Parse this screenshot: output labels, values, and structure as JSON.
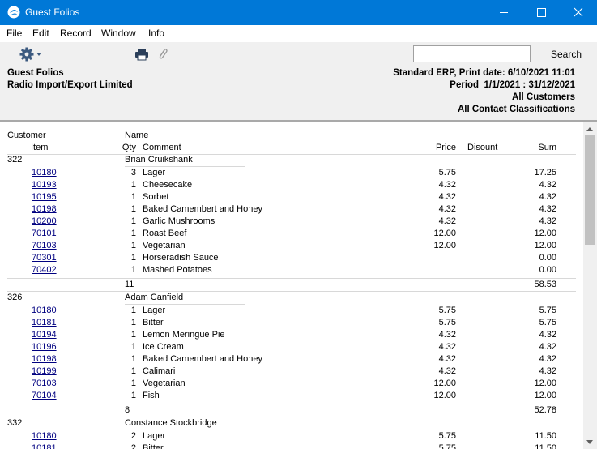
{
  "window": {
    "title": "Guest Folios",
    "minimize_glyph": "—",
    "maximize_glyph": "☐",
    "close_glyph": "✕"
  },
  "menu": [
    "File",
    "Edit",
    "Record",
    "Window",
    "Info"
  ],
  "toolbar": {
    "search_label": "Search",
    "search_value": ""
  },
  "icons": {
    "gear": "gear-icon",
    "print": "printer-icon",
    "attach": "paperclip-icon",
    "app": "app-logo-icon"
  },
  "colors": {
    "titlebar": "#0078d7",
    "link": "#000080",
    "header_bg": "#f0f0f0"
  },
  "header": {
    "report_name": "Guest Folios",
    "company": "Radio Import/Export Limited",
    "print_line": "Standard ERP, Print date: 6/10/2021 11:01",
    "period_line": "Period  1/1/2021 : 31/12/2021",
    "customers_line": "All Customers",
    "classifications_line": "All Contact Classifications"
  },
  "columns": {
    "customer": "Customer",
    "name": "Name",
    "item": "Item",
    "qty": "Qty",
    "comment": "Comment",
    "price": "Price",
    "discount": "Disount",
    "sum": "Sum"
  },
  "groups": [
    {
      "customer": "322",
      "name": "Brian Cruikshank",
      "rows": [
        {
          "item": "10180",
          "qty": "3",
          "comment": "Lager",
          "price": "5.75",
          "sum": "17.25"
        },
        {
          "item": "10193",
          "qty": "1",
          "comment": "Cheesecake",
          "price": "4.32",
          "sum": "4.32"
        },
        {
          "item": "10195",
          "qty": "1",
          "comment": "Sorbet",
          "price": "4.32",
          "sum": "4.32"
        },
        {
          "item": "10198",
          "qty": "1",
          "comment": "Baked Camembert and Honey",
          "price": "4.32",
          "sum": "4.32"
        },
        {
          "item": "10200",
          "qty": "1",
          "comment": "Garlic Mushrooms",
          "price": "4.32",
          "sum": "4.32"
        },
        {
          "item": "70101",
          "qty": "1",
          "comment": "Roast Beef",
          "price": "12.00",
          "sum": "12.00"
        },
        {
          "item": "70103",
          "qty": "1",
          "comment": "Vegetarian",
          "price": "12.00",
          "sum": "12.00"
        },
        {
          "item": "70301",
          "qty": "1",
          "comment": "Horseradish Sauce",
          "price": "",
          "sum": "0.00"
        },
        {
          "item": "70402",
          "qty": "1",
          "comment": "Mashed Potatoes",
          "price": "",
          "sum": "0.00"
        }
      ],
      "total_qty": "11",
      "total_sum": "58.53"
    },
    {
      "customer": "326",
      "name": "Adam Canfield",
      "rows": [
        {
          "item": "10180",
          "qty": "1",
          "comment": "Lager",
          "price": "5.75",
          "sum": "5.75"
        },
        {
          "item": "10181",
          "qty": "1",
          "comment": "Bitter",
          "price": "5.75",
          "sum": "5.75"
        },
        {
          "item": "10194",
          "qty": "1",
          "comment": "Lemon Meringue Pie",
          "price": "4.32",
          "sum": "4.32"
        },
        {
          "item": "10196",
          "qty": "1",
          "comment": "Ice Cream",
          "price": "4.32",
          "sum": "4.32"
        },
        {
          "item": "10198",
          "qty": "1",
          "comment": "Baked Camembert and Honey",
          "price": "4.32",
          "sum": "4.32"
        },
        {
          "item": "10199",
          "qty": "1",
          "comment": "Calimari",
          "price": "4.32",
          "sum": "4.32"
        },
        {
          "item": "70103",
          "qty": "1",
          "comment": "Vegetarian",
          "price": "12.00",
          "sum": "12.00"
        },
        {
          "item": "70104",
          "qty": "1",
          "comment": "Fish",
          "price": "12.00",
          "sum": "12.00"
        }
      ],
      "total_qty": "8",
      "total_sum": "52.78"
    },
    {
      "customer": "332",
      "name": "Constance Stockbridge",
      "rows": [
        {
          "item": "10180",
          "qty": "2",
          "comment": "Lager",
          "price": "5.75",
          "sum": "11.50"
        },
        {
          "item": "10181",
          "qty": "2",
          "comment": "Bitter",
          "price": "5.75",
          "sum": "11.50"
        }
      ],
      "total_qty": "",
      "total_sum": ""
    }
  ]
}
